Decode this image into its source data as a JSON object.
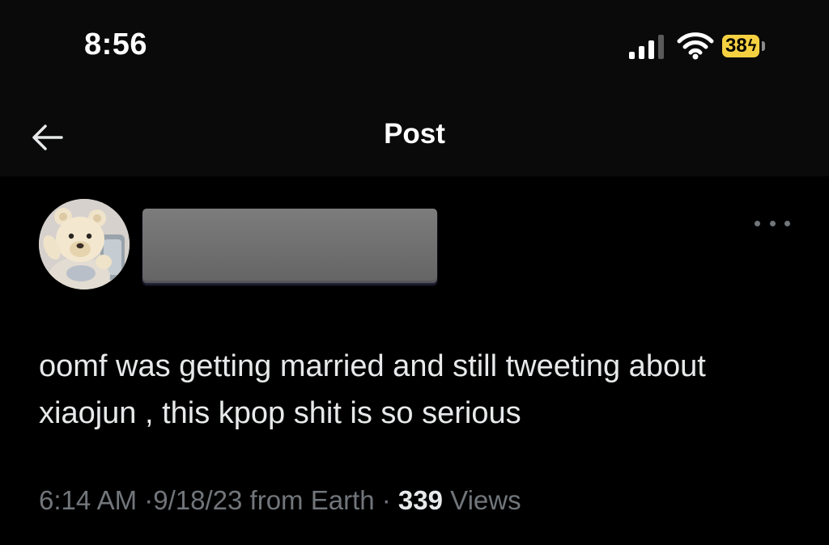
{
  "status_bar": {
    "time": "8:56",
    "battery_level": "38",
    "battery_icon": "bolt-icon",
    "battery_color": "#f5d142",
    "signal_icon": "cellular-signal-icon",
    "wifi_icon": "wifi-icon"
  },
  "header": {
    "title": "Post",
    "back_icon": "arrow-left-icon"
  },
  "post": {
    "author_avatar_icon": "teddy-bear-avatar",
    "author_name_redacted": true,
    "more_icon": "more-horizontal-icon",
    "text": "oomf was getting married and still tweeting about xiaojun , this kpop shit is so serious",
    "meta": {
      "time": "6:14 AM",
      "separator": "·",
      "date": "9/18/23",
      "source": "from Earth",
      "views_count": "339",
      "views_label": "Views"
    }
  },
  "colors": {
    "background": "#000000",
    "header_background": "#0a0a0a",
    "primary_text": "#e7e9ea",
    "secondary_text": "#71767b"
  }
}
